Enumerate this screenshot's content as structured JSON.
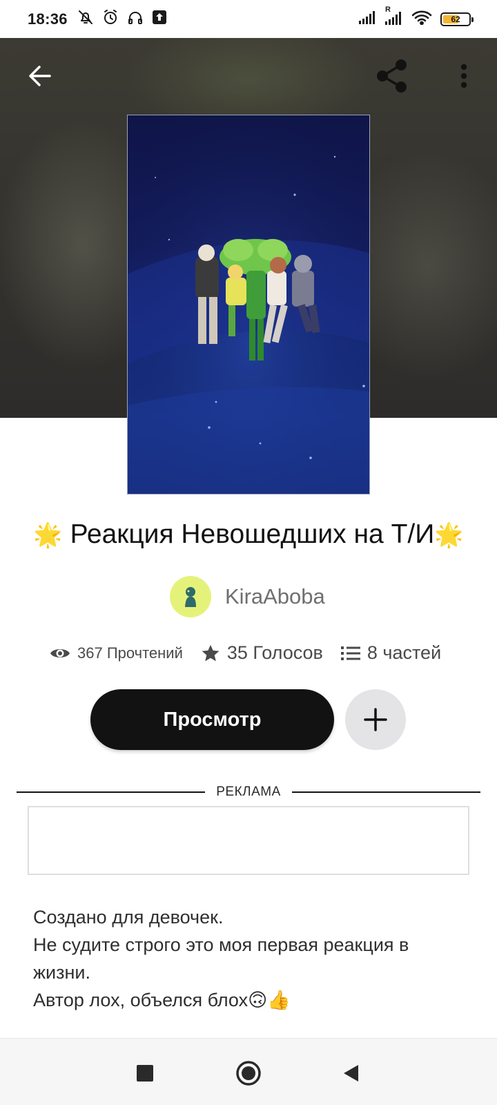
{
  "status_bar": {
    "time": "18:36",
    "battery_level": "62",
    "battery_fraction": 0.62,
    "left_icons": [
      "bell-off-icon",
      "alarm-icon",
      "headphones-icon",
      "upload-icon"
    ],
    "right_icons": [
      "signal-icon",
      "signal-roaming-icon",
      "wifi-icon",
      "battery-icon"
    ],
    "roaming_label": "R"
  },
  "header": {
    "back_icon": "arrow-left-icon",
    "share_icon": "share-icon",
    "menu_icon": "more-vertical-icon"
  },
  "story": {
    "title_emoji_left": "🌟",
    "title": "Реакция Невошедших на Т/И",
    "title_emoji_right": "🌟",
    "author": "KiraAboba"
  },
  "stats": {
    "reads": "367 Прочтений",
    "votes": "35 Голосов",
    "parts": "8 частей"
  },
  "actions": {
    "read_label": "Просмотр",
    "add_icon": "plus-icon"
  },
  "ad": {
    "label": "РЕКЛАМА"
  },
  "description": {
    "line1": "Создано для девочек.",
    "line2": "Не судите строго это моя первая реакция в жизни.",
    "line3": "Автор лох, объелся блох🙃👍"
  },
  "colors": {
    "primary_button": "#121212",
    "add_button": "#e4e3e6",
    "star": "#f6b71c",
    "avatar_bg": "#e5f27a",
    "battery_fill": "#f2b632"
  }
}
